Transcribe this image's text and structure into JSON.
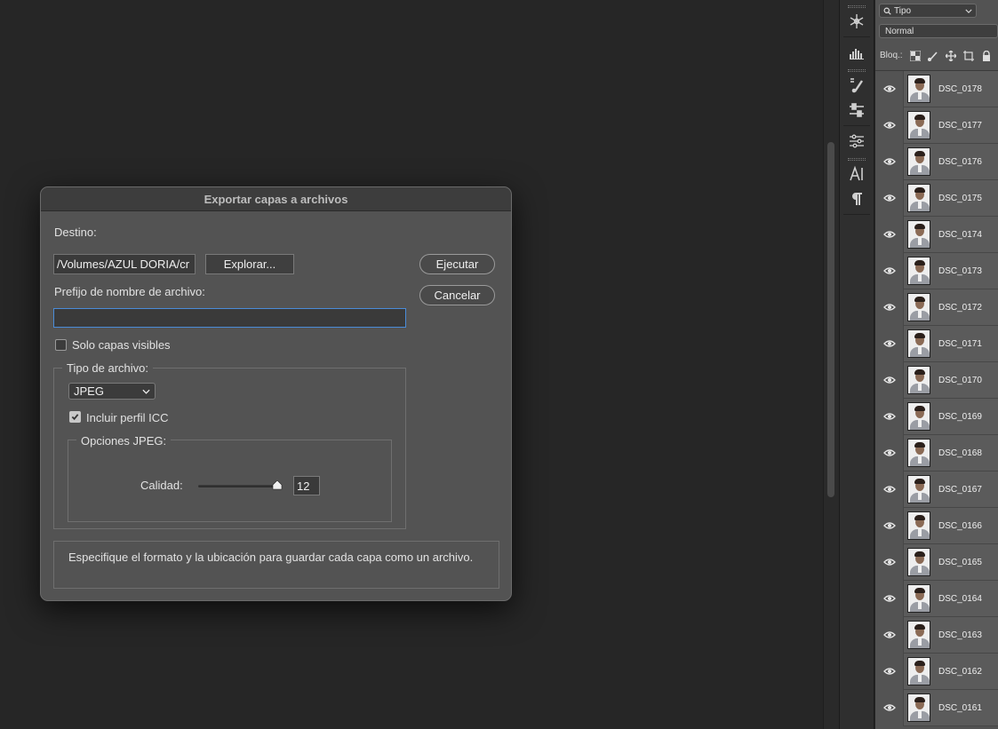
{
  "dialog": {
    "title": "Exportar capas a archivos",
    "destination_label": "Destino:",
    "destination_value": "/Volumes/AZUL DORIA/cr",
    "browse_label": "Explorar...",
    "run_label": "Ejecutar",
    "cancel_label": "Cancelar",
    "prefix_label": "Prefijo de nombre de archivo:",
    "prefix_value": "",
    "visible_only_label": "Solo capas visibles",
    "visible_only_checked": false,
    "file_type_legend": "Tipo de archivo:",
    "file_type_value": "JPEG",
    "include_icc_label": "Incluir perfil ICC",
    "include_icc_checked": true,
    "jpeg_options_legend": "Opciones JPEG:",
    "quality_label": "Calidad:",
    "quality_value": "12",
    "description": "Especifique el formato y la ubicación para guardar cada capa como un archivo."
  },
  "layers_panel": {
    "filter_label": "Tipo",
    "blend_mode": "Normal",
    "lock_label": "Bloq.:",
    "layers": [
      {
        "name": "DSC_0178"
      },
      {
        "name": "DSC_0177"
      },
      {
        "name": "DSC_0176"
      },
      {
        "name": "DSC_0175"
      },
      {
        "name": "DSC_0174"
      },
      {
        "name": "DSC_0173"
      },
      {
        "name": "DSC_0172"
      },
      {
        "name": "DSC_0171"
      },
      {
        "name": "DSC_0170"
      },
      {
        "name": "DSC_0169"
      },
      {
        "name": "DSC_0168"
      },
      {
        "name": "DSC_0167"
      },
      {
        "name": "DSC_0166"
      },
      {
        "name": "DSC_0165"
      },
      {
        "name": "DSC_0164"
      },
      {
        "name": "DSC_0163"
      },
      {
        "name": "DSC_0162"
      },
      {
        "name": "DSC_0161"
      }
    ]
  },
  "toolstrip": {
    "icons": [
      "snowflake-icon",
      "histogram-icon",
      "brush-settings-icon",
      "adjustments-icon",
      "properties-icon",
      "character-icon",
      "paragraph-icon"
    ]
  },
  "colors": {
    "panel_bg": "#535353",
    "canvas_bg": "#262626",
    "focus_ring": "#4a8cd8"
  }
}
